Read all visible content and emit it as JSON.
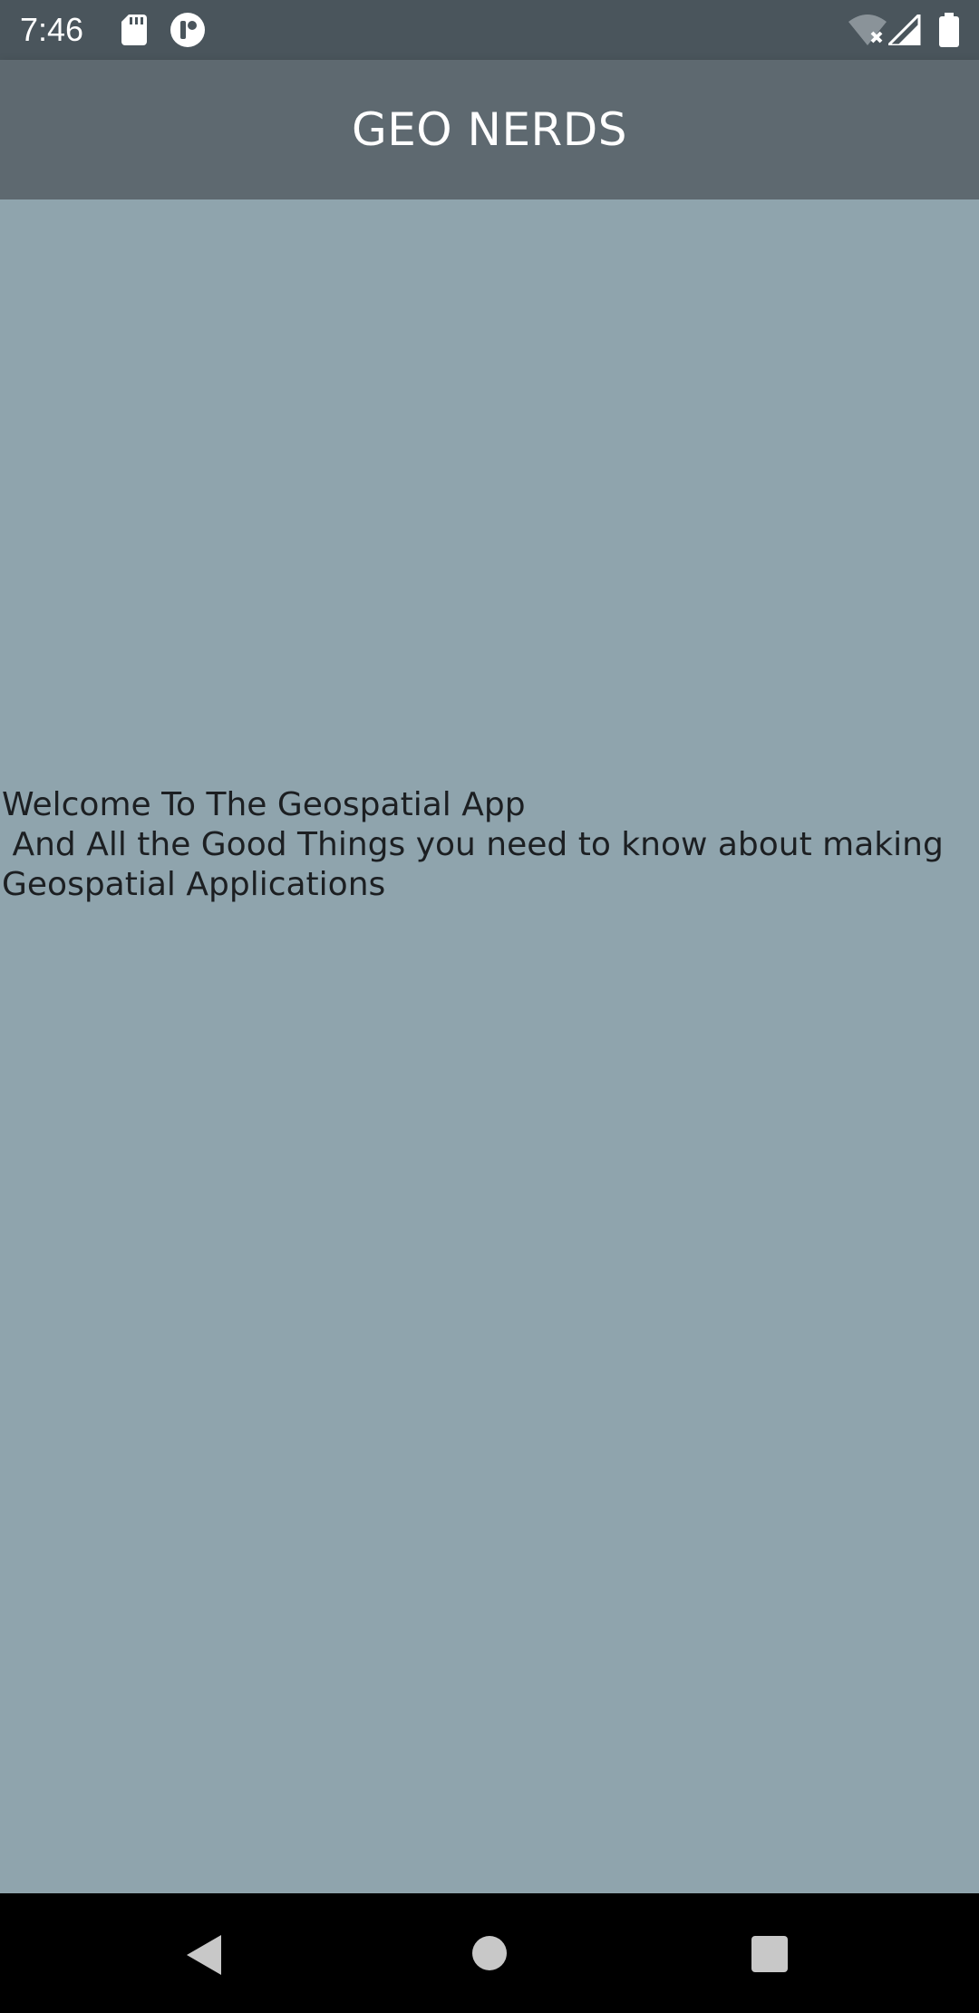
{
  "status_bar": {
    "time": "7:46",
    "icons": [
      "sd-card-icon",
      "app-notification-icon",
      "wifi-off-icon",
      "cell-signal-icon",
      "battery-icon"
    ]
  },
  "app_bar": {
    "title": "GEO NERDS",
    "background": "#5e6970"
  },
  "main": {
    "welcome_text": "Welcome To The Geospatial App\n And All the Good Things you need to know about making Geospatial Applications",
    "background": "#8fa4ad"
  },
  "nav_bar": {
    "buttons": [
      "back-icon",
      "home-icon",
      "recents-icon"
    ]
  }
}
